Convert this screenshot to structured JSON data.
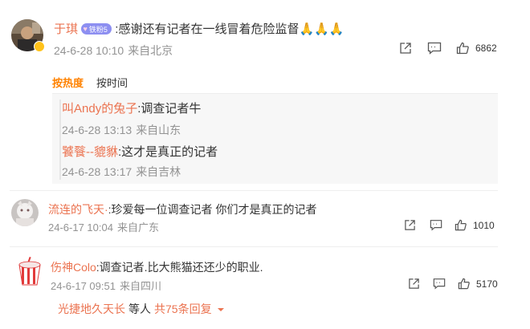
{
  "comments": [
    {
      "user": "于琪",
      "badge": "铁粉5",
      "text": ":感谢还有记者在一线冒着危险监督",
      "emoji": "🙏🙏🙏",
      "date": "24-6-28 10:10",
      "location": "来自北京",
      "likes": "6862"
    },
    {
      "user": "流连的飞天·",
      "text": ":珍爱每一位调查记者 你们才是真正的记者",
      "date": "24-6-17 10:04",
      "location": "来自广东",
      "likes": "1010"
    },
    {
      "user": "伤神Colo",
      "text": ":调查记者.比大熊猫还还少的职业.",
      "date": "24-6-17 09:51",
      "location": "来自四川",
      "likes": "5170"
    }
  ],
  "sort": {
    "hot": "按热度",
    "time": "按时间"
  },
  "replies": [
    {
      "user": "叫Andy的兔子",
      "text": ":调查记者牛",
      "date": "24-6-28 13:13",
      "location": "来自山东"
    },
    {
      "user": "饕餮--貔貅",
      "text": ":这才是真正的记者",
      "date": "24-6-28 13:17",
      "location": "来自吉林"
    }
  ],
  "more_replies": {
    "user": "光捷地久天长",
    "middle": "等人",
    "count": "共75条回复"
  },
  "colors": {
    "username": "#eb7350",
    "sort_active": "#ff8200",
    "badge": "#8d8ff1",
    "meta": "#939393"
  },
  "icons": [
    "share-icon",
    "comment-icon",
    "like-icon",
    "chevron-down-icon",
    "verified-icon"
  ]
}
